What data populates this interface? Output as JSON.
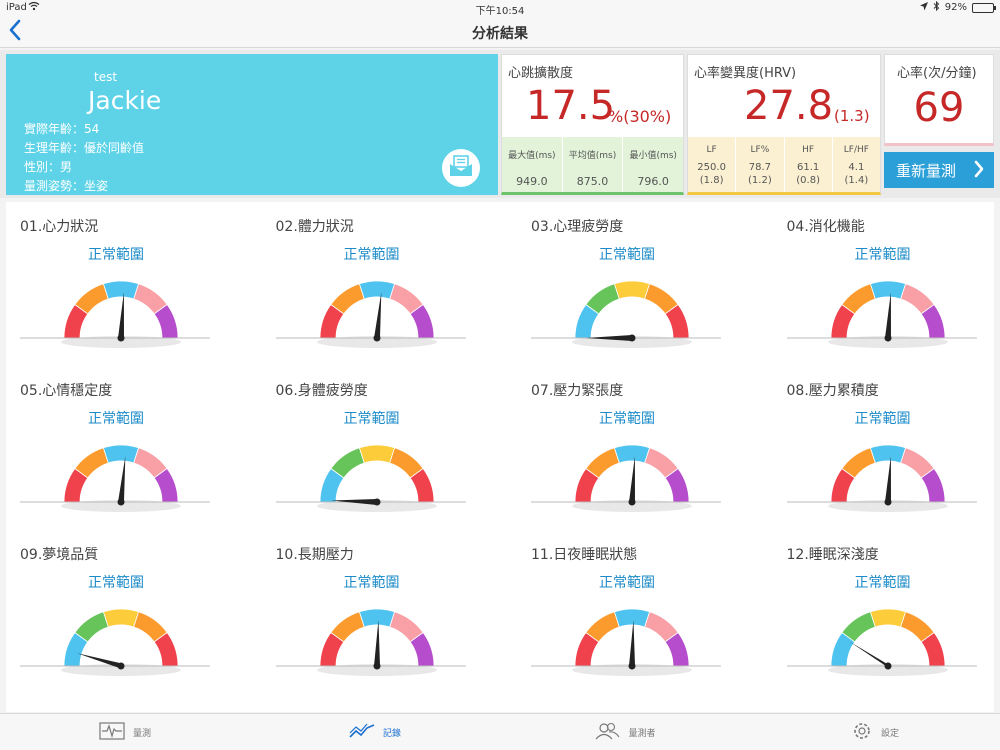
{
  "status_bar": {
    "carrier": "iPad",
    "time": "下午10:54",
    "battery": "92%",
    "battery_level": 0.92
  },
  "nav": {
    "title": "分析結果"
  },
  "profile": {
    "sub": "test",
    "name": "Jackie",
    "info": [
      "實際年齡：54",
      "生理年齡：優於同齡值",
      "性別：男",
      "量測姿勢：坐姿"
    ]
  },
  "heart_spread": {
    "title": "心跳擴散度",
    "value": "17.5",
    "unit": "%(30%)",
    "stats": [
      {
        "label": "最大值(ms)",
        "value": "949.0"
      },
      {
        "label": "平均值(ms)",
        "value": "875.0"
      },
      {
        "label": "最小值(ms)",
        "value": "796.0"
      }
    ]
  },
  "hrv": {
    "title": "心率變異度(HRV)",
    "value": "27.8",
    "unit": "(1.3)",
    "stats": [
      {
        "label": "LF",
        "value": "250.0",
        "sub": "(1.8)"
      },
      {
        "label": "LF%",
        "value": "78.7",
        "sub": "(1.2)"
      },
      {
        "label": "HF",
        "value": "61.1",
        "sub": "(0.8)"
      },
      {
        "label": "LF/HF",
        "value": "4.1",
        "sub": "(1.4)"
      }
    ]
  },
  "heart_rate": {
    "title": "心率(次/分鐘)",
    "value": "69"
  },
  "remeasure": {
    "label": "重新量測"
  },
  "colors": {
    "red": "#f0424d",
    "orange": "#fb9b2d",
    "blue": "#4ec3ef",
    "pink": "#f8a0a6",
    "purple": "#b54dcc",
    "green": "#67c45a",
    "yellow": "#fccc3b",
    "status": "#1c8bc8"
  },
  "gauges": [
    {
      "label": "01.心力狀況",
      "status": "正常範圍",
      "scheme": "A",
      "needle": 0.52
    },
    {
      "label": "02.體力狀況",
      "status": "正常範圍",
      "scheme": "A",
      "needle": 0.53
    },
    {
      "label": "03.心理疲勞度",
      "status": "正常範圍",
      "scheme": "B",
      "needle": 0.0
    },
    {
      "label": "04.消化機能",
      "status": "正常範圍",
      "scheme": "A",
      "needle": 0.52
    },
    {
      "label": "05.心情穩定度",
      "status": "正常範圍",
      "scheme": "A",
      "needle": 0.53
    },
    {
      "label": "06.身體疲勞度",
      "status": "正常範圍",
      "scheme": "B",
      "needle": 0.01
    },
    {
      "label": "07.壓力緊張度",
      "status": "正常範圍",
      "scheme": "A",
      "needle": 0.52
    },
    {
      "label": "08.壓力累積度",
      "status": "正常範圍",
      "scheme": "A",
      "needle": 0.52
    },
    {
      "label": "09.夢境品質",
      "status": "正常範圍",
      "scheme": "B",
      "needle": 0.09
    },
    {
      "label": "10.長期壓力",
      "status": "正常範圍",
      "scheme": "A",
      "needle": 0.51
    },
    {
      "label": "11.日夜睡眠狀態",
      "status": "正常範圍",
      "scheme": "A",
      "needle": 0.51
    },
    {
      "label": "12.睡眠深淺度",
      "status": "正常範圍",
      "scheme": "B",
      "needle": 0.18
    }
  ],
  "tabs": [
    {
      "label": "量測",
      "icon": "ecg-icon",
      "active": false
    },
    {
      "label": "記錄",
      "icon": "trend-icon",
      "active": true
    },
    {
      "label": "量測者",
      "icon": "users-icon",
      "active": false
    },
    {
      "label": "設定",
      "icon": "gear-icon",
      "active": false
    }
  ]
}
